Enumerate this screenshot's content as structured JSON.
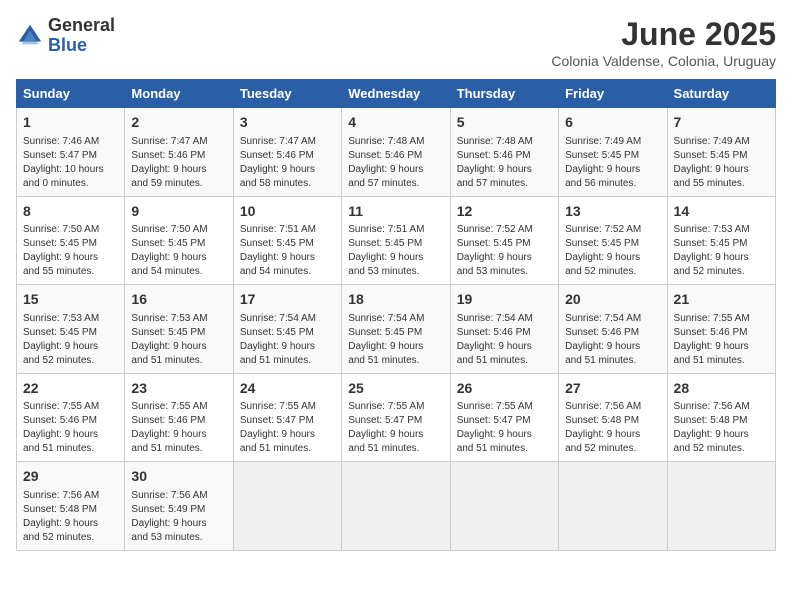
{
  "logo": {
    "general": "General",
    "blue": "Blue"
  },
  "title": "June 2025",
  "subtitle": "Colonia Valdense, Colonia, Uruguay",
  "days_of_week": [
    "Sunday",
    "Monday",
    "Tuesday",
    "Wednesday",
    "Thursday",
    "Friday",
    "Saturday"
  ],
  "weeks": [
    [
      {
        "day": 1,
        "info": "Sunrise: 7:46 AM\nSunset: 5:47 PM\nDaylight: 10 hours\nand 0 minutes."
      },
      {
        "day": 2,
        "info": "Sunrise: 7:47 AM\nSunset: 5:46 PM\nDaylight: 9 hours\nand 59 minutes."
      },
      {
        "day": 3,
        "info": "Sunrise: 7:47 AM\nSunset: 5:46 PM\nDaylight: 9 hours\nand 58 minutes."
      },
      {
        "day": 4,
        "info": "Sunrise: 7:48 AM\nSunset: 5:46 PM\nDaylight: 9 hours\nand 57 minutes."
      },
      {
        "day": 5,
        "info": "Sunrise: 7:48 AM\nSunset: 5:46 PM\nDaylight: 9 hours\nand 57 minutes."
      },
      {
        "day": 6,
        "info": "Sunrise: 7:49 AM\nSunset: 5:45 PM\nDaylight: 9 hours\nand 56 minutes."
      },
      {
        "day": 7,
        "info": "Sunrise: 7:49 AM\nSunset: 5:45 PM\nDaylight: 9 hours\nand 55 minutes."
      }
    ],
    [
      {
        "day": 8,
        "info": "Sunrise: 7:50 AM\nSunset: 5:45 PM\nDaylight: 9 hours\nand 55 minutes."
      },
      {
        "day": 9,
        "info": "Sunrise: 7:50 AM\nSunset: 5:45 PM\nDaylight: 9 hours\nand 54 minutes."
      },
      {
        "day": 10,
        "info": "Sunrise: 7:51 AM\nSunset: 5:45 PM\nDaylight: 9 hours\nand 54 minutes."
      },
      {
        "day": 11,
        "info": "Sunrise: 7:51 AM\nSunset: 5:45 PM\nDaylight: 9 hours\nand 53 minutes."
      },
      {
        "day": 12,
        "info": "Sunrise: 7:52 AM\nSunset: 5:45 PM\nDaylight: 9 hours\nand 53 minutes."
      },
      {
        "day": 13,
        "info": "Sunrise: 7:52 AM\nSunset: 5:45 PM\nDaylight: 9 hours\nand 52 minutes."
      },
      {
        "day": 14,
        "info": "Sunrise: 7:53 AM\nSunset: 5:45 PM\nDaylight: 9 hours\nand 52 minutes."
      }
    ],
    [
      {
        "day": 15,
        "info": "Sunrise: 7:53 AM\nSunset: 5:45 PM\nDaylight: 9 hours\nand 52 minutes."
      },
      {
        "day": 16,
        "info": "Sunrise: 7:53 AM\nSunset: 5:45 PM\nDaylight: 9 hours\nand 51 minutes."
      },
      {
        "day": 17,
        "info": "Sunrise: 7:54 AM\nSunset: 5:45 PM\nDaylight: 9 hours\nand 51 minutes."
      },
      {
        "day": 18,
        "info": "Sunrise: 7:54 AM\nSunset: 5:45 PM\nDaylight: 9 hours\nand 51 minutes."
      },
      {
        "day": 19,
        "info": "Sunrise: 7:54 AM\nSunset: 5:46 PM\nDaylight: 9 hours\nand 51 minutes."
      },
      {
        "day": 20,
        "info": "Sunrise: 7:54 AM\nSunset: 5:46 PM\nDaylight: 9 hours\nand 51 minutes."
      },
      {
        "day": 21,
        "info": "Sunrise: 7:55 AM\nSunset: 5:46 PM\nDaylight: 9 hours\nand 51 minutes."
      }
    ],
    [
      {
        "day": 22,
        "info": "Sunrise: 7:55 AM\nSunset: 5:46 PM\nDaylight: 9 hours\nand 51 minutes."
      },
      {
        "day": 23,
        "info": "Sunrise: 7:55 AM\nSunset: 5:46 PM\nDaylight: 9 hours\nand 51 minutes."
      },
      {
        "day": 24,
        "info": "Sunrise: 7:55 AM\nSunset: 5:47 PM\nDaylight: 9 hours\nand 51 minutes."
      },
      {
        "day": 25,
        "info": "Sunrise: 7:55 AM\nSunset: 5:47 PM\nDaylight: 9 hours\nand 51 minutes."
      },
      {
        "day": 26,
        "info": "Sunrise: 7:55 AM\nSunset: 5:47 PM\nDaylight: 9 hours\nand 51 minutes."
      },
      {
        "day": 27,
        "info": "Sunrise: 7:56 AM\nSunset: 5:48 PM\nDaylight: 9 hours\nand 52 minutes."
      },
      {
        "day": 28,
        "info": "Sunrise: 7:56 AM\nSunset: 5:48 PM\nDaylight: 9 hours\nand 52 minutes."
      }
    ],
    [
      {
        "day": 29,
        "info": "Sunrise: 7:56 AM\nSunset: 5:48 PM\nDaylight: 9 hours\nand 52 minutes."
      },
      {
        "day": 30,
        "info": "Sunrise: 7:56 AM\nSunset: 5:49 PM\nDaylight: 9 hours\nand 53 minutes."
      },
      null,
      null,
      null,
      null,
      null
    ]
  ]
}
